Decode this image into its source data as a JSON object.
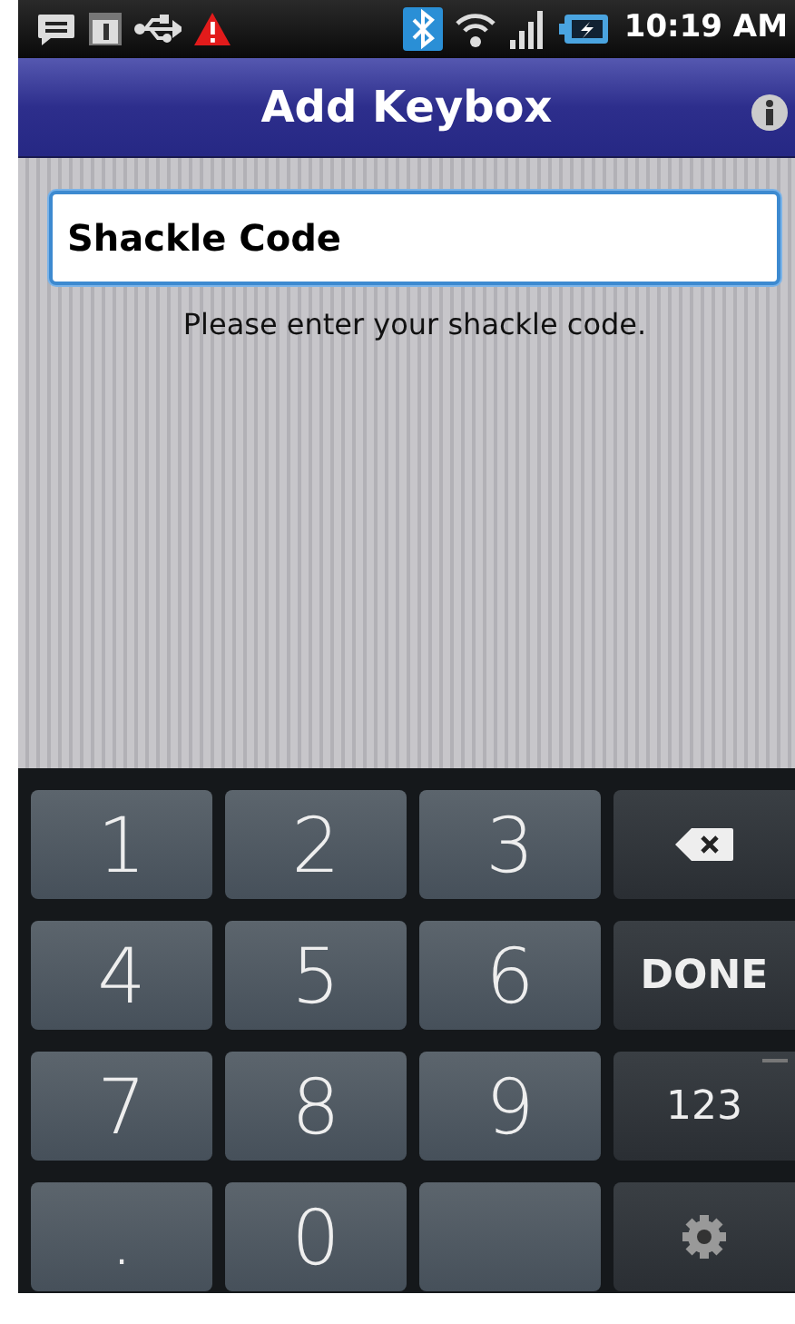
{
  "status_bar": {
    "time": "10:19 AM"
  },
  "title_bar": {
    "title": "Add Keybox"
  },
  "shackle_field": {
    "value": "Shackle Code",
    "focused": true
  },
  "hint": "Please enter your shackle code.",
  "keyboard": {
    "rows": [
      [
        {
          "kind": "digit",
          "label": "1"
        },
        {
          "kind": "digit",
          "label": "2"
        },
        {
          "kind": "digit",
          "label": "3"
        },
        {
          "kind": "backspace"
        }
      ],
      [
        {
          "kind": "digit",
          "label": "4"
        },
        {
          "kind": "digit",
          "label": "5"
        },
        {
          "kind": "digit",
          "label": "6"
        },
        {
          "kind": "action",
          "label": "DONE"
        }
      ],
      [
        {
          "kind": "digit",
          "label": "7"
        },
        {
          "kind": "digit",
          "label": "8"
        },
        {
          "kind": "digit",
          "label": "9"
        },
        {
          "kind": "mode",
          "label": "123"
        }
      ],
      [
        {
          "kind": "digit",
          "label": "."
        },
        {
          "kind": "digit",
          "label": "0"
        },
        {
          "kind": "blank"
        },
        {
          "kind": "settings"
        }
      ]
    ]
  }
}
